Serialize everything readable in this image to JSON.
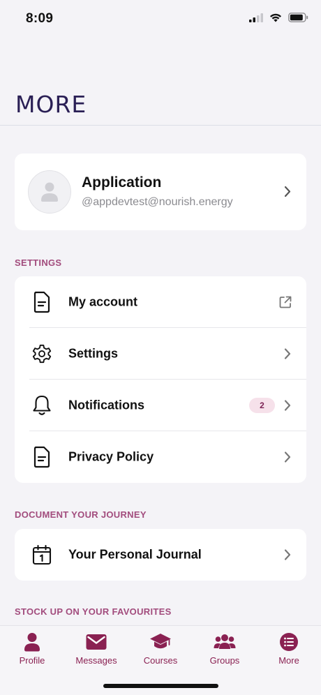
{
  "status_bar": {
    "time": "8:09"
  },
  "page": {
    "title": "MORE"
  },
  "profile": {
    "name": "Application",
    "handle": "@appdevtest@nourish.energy"
  },
  "sections": [
    {
      "label": "SETTINGS"
    },
    {
      "label": "DOCUMENT YOUR JOURNEY"
    },
    {
      "label": "STOCK UP ON YOUR FAVOURITES"
    }
  ],
  "settings_items": [
    {
      "label": "My account",
      "icon": "document-icon",
      "trailing": "external-link-icon"
    },
    {
      "label": "Settings",
      "icon": "gear-icon",
      "trailing": "chevron-right-icon"
    },
    {
      "label": "Notifications",
      "icon": "bell-icon",
      "trailing": "chevron-right-icon",
      "badge": "2"
    },
    {
      "label": "Privacy Policy",
      "icon": "document-icon",
      "trailing": "chevron-right-icon"
    }
  ],
  "journey_items": [
    {
      "label": "Your Personal Journal",
      "icon": "calendar-icon",
      "trailing": "chevron-right-icon"
    }
  ],
  "tabs": [
    {
      "label": "Profile",
      "icon": "person-icon"
    },
    {
      "label": "Messages",
      "icon": "envelope-icon"
    },
    {
      "label": "Courses",
      "icon": "graduation-cap-icon"
    },
    {
      "label": "Groups",
      "icon": "group-icon"
    },
    {
      "label": "More",
      "icon": "menu-list-icon"
    }
  ],
  "colors": {
    "accent": "#8a2152",
    "section_label": "#a24c7d",
    "title": "#2a1f55",
    "background": "#f4f3f7",
    "badge_bg": "#f6e1ea"
  }
}
